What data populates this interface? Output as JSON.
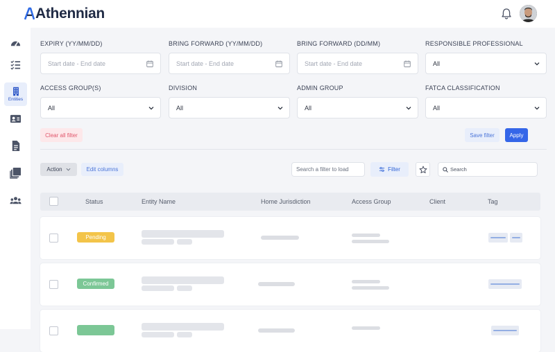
{
  "app": {
    "name": "Athennian"
  },
  "sidebar": {
    "items": [
      {
        "name": "dashboard",
        "label": ""
      },
      {
        "name": "tasks",
        "label": ""
      },
      {
        "name": "entities",
        "label": "Entities",
        "active": true
      },
      {
        "name": "contacts",
        "label": ""
      },
      {
        "name": "documents",
        "label": ""
      },
      {
        "name": "collections",
        "label": ""
      },
      {
        "name": "people",
        "label": ""
      }
    ]
  },
  "filters": {
    "expiry": {
      "label": "EXPIRY (YY/MM/DD)",
      "placeholder": "Start date - End date"
    },
    "bring_forward_ymd": {
      "label": "BRING FORWARD (YY/MM/DD)",
      "placeholder": "Start date - End date"
    },
    "bring_forward_dm": {
      "label": "BRING FORWARD (DD/MM)",
      "placeholder": "Start date - End date"
    },
    "responsible_professional": {
      "label": "RESPONSIBLE PROFESSIONAL",
      "value": "All"
    },
    "access_groups": {
      "label": "ACCESS GROUP(S)",
      "value": "All"
    },
    "division": {
      "label": "DIVISION",
      "value": "All"
    },
    "admin_group": {
      "label": "ADMIN GROUP",
      "value": "All"
    },
    "fatca": {
      "label": "FATCA CLASSIFICATION",
      "value": "All"
    },
    "clear_label": "Clear all filter",
    "save_label": "Save filter",
    "apply_label": "Apply"
  },
  "toolbar": {
    "action_label": "Action",
    "edit_columns_label": "Edit columns",
    "load_filter_placeholder": "Search a filter to load",
    "filter_label": "Filter",
    "search_placeholder": "Search"
  },
  "table": {
    "columns": [
      "Status",
      "Entity Name",
      "Home Jurisdiction",
      "Access Group",
      "Client",
      "Tag"
    ],
    "rows": [
      {
        "status": "Pending"
      },
      {
        "status": "Confirmed"
      },
      {
        "status": ""
      }
    ]
  },
  "colors": {
    "accent": "#3566e8",
    "pending": "#f3c449",
    "confirmed": "#7cc796",
    "clear_bg": "#fde8ea",
    "clear_text": "#e0566b"
  }
}
